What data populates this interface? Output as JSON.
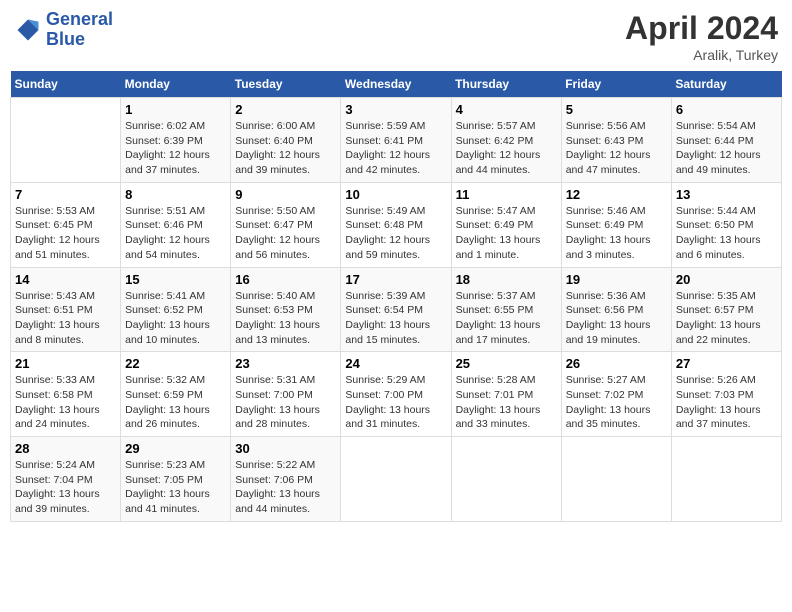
{
  "logo": {
    "line1": "General",
    "line2": "Blue"
  },
  "title": "April 2024",
  "subtitle": "Aralik, Turkey",
  "days_header": [
    "Sunday",
    "Monday",
    "Tuesday",
    "Wednesday",
    "Thursday",
    "Friday",
    "Saturday"
  ],
  "weeks": [
    [
      {
        "num": "",
        "info": ""
      },
      {
        "num": "1",
        "info": "Sunrise: 6:02 AM\nSunset: 6:39 PM\nDaylight: 12 hours\nand 37 minutes."
      },
      {
        "num": "2",
        "info": "Sunrise: 6:00 AM\nSunset: 6:40 PM\nDaylight: 12 hours\nand 39 minutes."
      },
      {
        "num": "3",
        "info": "Sunrise: 5:59 AM\nSunset: 6:41 PM\nDaylight: 12 hours\nand 42 minutes."
      },
      {
        "num": "4",
        "info": "Sunrise: 5:57 AM\nSunset: 6:42 PM\nDaylight: 12 hours\nand 44 minutes."
      },
      {
        "num": "5",
        "info": "Sunrise: 5:56 AM\nSunset: 6:43 PM\nDaylight: 12 hours\nand 47 minutes."
      },
      {
        "num": "6",
        "info": "Sunrise: 5:54 AM\nSunset: 6:44 PM\nDaylight: 12 hours\nand 49 minutes."
      }
    ],
    [
      {
        "num": "7",
        "info": "Sunrise: 5:53 AM\nSunset: 6:45 PM\nDaylight: 12 hours\nand 51 minutes."
      },
      {
        "num": "8",
        "info": "Sunrise: 5:51 AM\nSunset: 6:46 PM\nDaylight: 12 hours\nand 54 minutes."
      },
      {
        "num": "9",
        "info": "Sunrise: 5:50 AM\nSunset: 6:47 PM\nDaylight: 12 hours\nand 56 minutes."
      },
      {
        "num": "10",
        "info": "Sunrise: 5:49 AM\nSunset: 6:48 PM\nDaylight: 12 hours\nand 59 minutes."
      },
      {
        "num": "11",
        "info": "Sunrise: 5:47 AM\nSunset: 6:49 PM\nDaylight: 13 hours\nand 1 minute."
      },
      {
        "num": "12",
        "info": "Sunrise: 5:46 AM\nSunset: 6:49 PM\nDaylight: 13 hours\nand 3 minutes."
      },
      {
        "num": "13",
        "info": "Sunrise: 5:44 AM\nSunset: 6:50 PM\nDaylight: 13 hours\nand 6 minutes."
      }
    ],
    [
      {
        "num": "14",
        "info": "Sunrise: 5:43 AM\nSunset: 6:51 PM\nDaylight: 13 hours\nand 8 minutes."
      },
      {
        "num": "15",
        "info": "Sunrise: 5:41 AM\nSunset: 6:52 PM\nDaylight: 13 hours\nand 10 minutes."
      },
      {
        "num": "16",
        "info": "Sunrise: 5:40 AM\nSunset: 6:53 PM\nDaylight: 13 hours\nand 13 minutes."
      },
      {
        "num": "17",
        "info": "Sunrise: 5:39 AM\nSunset: 6:54 PM\nDaylight: 13 hours\nand 15 minutes."
      },
      {
        "num": "18",
        "info": "Sunrise: 5:37 AM\nSunset: 6:55 PM\nDaylight: 13 hours\nand 17 minutes."
      },
      {
        "num": "19",
        "info": "Sunrise: 5:36 AM\nSunset: 6:56 PM\nDaylight: 13 hours\nand 19 minutes."
      },
      {
        "num": "20",
        "info": "Sunrise: 5:35 AM\nSunset: 6:57 PM\nDaylight: 13 hours\nand 22 minutes."
      }
    ],
    [
      {
        "num": "21",
        "info": "Sunrise: 5:33 AM\nSunset: 6:58 PM\nDaylight: 13 hours\nand 24 minutes."
      },
      {
        "num": "22",
        "info": "Sunrise: 5:32 AM\nSunset: 6:59 PM\nDaylight: 13 hours\nand 26 minutes."
      },
      {
        "num": "23",
        "info": "Sunrise: 5:31 AM\nSunset: 7:00 PM\nDaylight: 13 hours\nand 28 minutes."
      },
      {
        "num": "24",
        "info": "Sunrise: 5:29 AM\nSunset: 7:00 PM\nDaylight: 13 hours\nand 31 minutes."
      },
      {
        "num": "25",
        "info": "Sunrise: 5:28 AM\nSunset: 7:01 PM\nDaylight: 13 hours\nand 33 minutes."
      },
      {
        "num": "26",
        "info": "Sunrise: 5:27 AM\nSunset: 7:02 PM\nDaylight: 13 hours\nand 35 minutes."
      },
      {
        "num": "27",
        "info": "Sunrise: 5:26 AM\nSunset: 7:03 PM\nDaylight: 13 hours\nand 37 minutes."
      }
    ],
    [
      {
        "num": "28",
        "info": "Sunrise: 5:24 AM\nSunset: 7:04 PM\nDaylight: 13 hours\nand 39 minutes."
      },
      {
        "num": "29",
        "info": "Sunrise: 5:23 AM\nSunset: 7:05 PM\nDaylight: 13 hours\nand 41 minutes."
      },
      {
        "num": "30",
        "info": "Sunrise: 5:22 AM\nSunset: 7:06 PM\nDaylight: 13 hours\nand 44 minutes."
      },
      {
        "num": "",
        "info": ""
      },
      {
        "num": "",
        "info": ""
      },
      {
        "num": "",
        "info": ""
      },
      {
        "num": "",
        "info": ""
      }
    ]
  ]
}
